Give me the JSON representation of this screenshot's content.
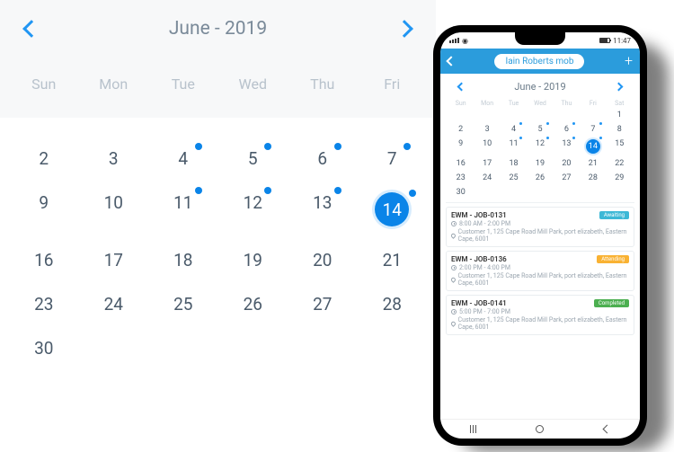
{
  "desktop": {
    "title": "June - 2019",
    "days": [
      "Sun",
      "Mon",
      "Tue",
      "Wed",
      "Thu",
      "Fri"
    ],
    "grid": [
      [
        {
          "n": ""
        },
        {
          "n": ""
        },
        {
          "n": ""
        },
        {
          "n": ""
        },
        {
          "n": ""
        },
        {
          "n": ""
        }
      ],
      [
        {
          "n": "2"
        },
        {
          "n": "3"
        },
        {
          "n": "4",
          "dot": true
        },
        {
          "n": "5",
          "dot": true
        },
        {
          "n": "6",
          "dot": true
        },
        {
          "n": "7",
          "dot": true
        }
      ],
      [
        {
          "n": "9"
        },
        {
          "n": "10"
        },
        {
          "n": "11",
          "dot": true
        },
        {
          "n": "12",
          "dot": true
        },
        {
          "n": "13",
          "dot": true
        },
        {
          "n": "14",
          "dot": true,
          "sel": true
        }
      ],
      [
        {
          "n": "16"
        },
        {
          "n": "17"
        },
        {
          "n": "18"
        },
        {
          "n": "19"
        },
        {
          "n": "20"
        },
        {
          "n": "21"
        }
      ],
      [
        {
          "n": "23"
        },
        {
          "n": "24"
        },
        {
          "n": "25"
        },
        {
          "n": "26"
        },
        {
          "n": "27"
        },
        {
          "n": "28"
        }
      ],
      [
        {
          "n": "30"
        },
        {
          "n": ""
        },
        {
          "n": ""
        },
        {
          "n": ""
        },
        {
          "n": ""
        },
        {
          "n": ""
        }
      ]
    ]
  },
  "phone": {
    "status_time": "11:47",
    "user_pill": "Iain Roberts mob",
    "cal_title": "June - 2019",
    "days": [
      "Sun",
      "Mon",
      "Tue",
      "Wed",
      "Thu",
      "Fri",
      "Sat"
    ],
    "grid": [
      [
        {
          "n": ""
        },
        {
          "n": ""
        },
        {
          "n": ""
        },
        {
          "n": ""
        },
        {
          "n": ""
        },
        {
          "n": ""
        },
        {
          "n": "1"
        }
      ],
      [
        {
          "n": "2"
        },
        {
          "n": "3"
        },
        {
          "n": "4",
          "dot": true
        },
        {
          "n": "5",
          "dot": true
        },
        {
          "n": "6",
          "dot": true
        },
        {
          "n": "7",
          "dot": true
        },
        {
          "n": "8"
        }
      ],
      [
        {
          "n": "9"
        },
        {
          "n": "10"
        },
        {
          "n": "11",
          "dot": true
        },
        {
          "n": "12",
          "dot": true
        },
        {
          "n": "13",
          "dot": true
        },
        {
          "n": "14",
          "dot": true,
          "sel": true
        },
        {
          "n": "15"
        }
      ],
      [
        {
          "n": "16"
        },
        {
          "n": "17"
        },
        {
          "n": "18"
        },
        {
          "n": "19"
        },
        {
          "n": "20"
        },
        {
          "n": "21"
        },
        {
          "n": "22"
        }
      ],
      [
        {
          "n": "23"
        },
        {
          "n": "24"
        },
        {
          "n": "25"
        },
        {
          "n": "26"
        },
        {
          "n": "27"
        },
        {
          "n": "28"
        },
        {
          "n": "29"
        }
      ],
      [
        {
          "n": "30"
        },
        {
          "n": ""
        },
        {
          "n": ""
        },
        {
          "n": ""
        },
        {
          "n": ""
        },
        {
          "n": ""
        },
        {
          "n": ""
        }
      ]
    ],
    "jobs": [
      {
        "title": "EWM - JOB-0131",
        "time": "8:00 AM - 2:00 PM",
        "loc": "Customer 1, 125 Cape Road Mill Park, port elizabeth, Eastern Cape, 6001",
        "status": "Awaiting",
        "cls": "b-wait"
      },
      {
        "title": "EWM - JOB-0136",
        "time": "2:00 PM - 4:00 PM",
        "loc": "Customer 1, 125 Cape Road Mill Park, port elizabeth, Eastern Cape, 6001",
        "status": "Attending",
        "cls": "b-attend"
      },
      {
        "title": "EWM - JOB-0141",
        "time": "5:00 PM - 7:00 PM",
        "loc": "Customer 1, 125 Cape Road Mill Park, port elizabeth, Eastern Cape, 6001",
        "status": "Completed",
        "cls": "b-comp"
      }
    ]
  }
}
